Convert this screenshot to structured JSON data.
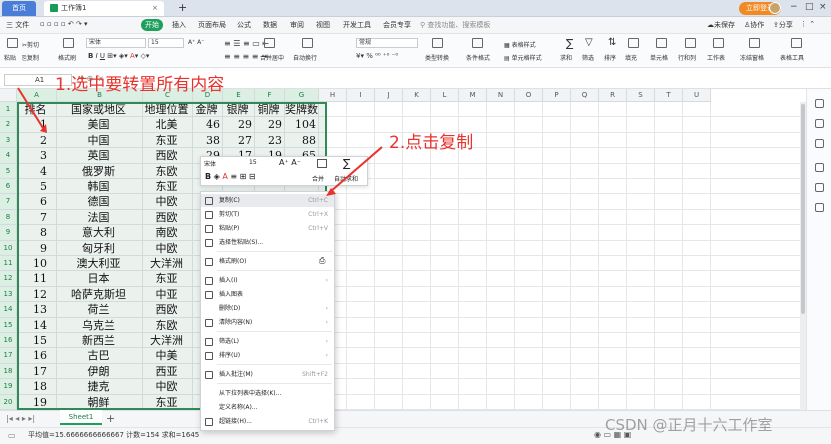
{
  "titlebar": {
    "home_tab": "首页",
    "doc_tab": "工作簿1",
    "login": "立即登录"
  },
  "menubar": {
    "file_menu": "三 文件",
    "items": [
      "开始",
      "插入",
      "页面布局",
      "公式",
      "数据",
      "审阅",
      "视图",
      "开发工具",
      "会员专享"
    ],
    "search_placeholder": "查找功能、搜索模板",
    "unsaved": "未保存",
    "collab": "协作",
    "share": "分享"
  },
  "ribbon": {
    "paste": "粘贴",
    "cut": "剪切",
    "copy": "复制",
    "format_painter": "格式刷",
    "font_name": "宋体",
    "font_size": "15",
    "merge_center": "合并居中",
    "auto_wrap": "自动换行",
    "number_format": "常规",
    "type_convert": "类型转换",
    "cond_format": "条件格式",
    "table_style": "表格样式",
    "cell_style": "单元格样式",
    "sum": "求和",
    "filter": "筛选",
    "sort": "排序",
    "fill": "填充",
    "cell": "单元格",
    "row_col": "行和列",
    "worksheet": "工作表",
    "freeze": "冻结窗格",
    "table_tools": "表格工具"
  },
  "formula": {
    "cell_ref": "A1"
  },
  "columns": [
    "A",
    "B",
    "C",
    "D",
    "E",
    "F",
    "G",
    "H",
    "I",
    "J",
    "K",
    "L",
    "M",
    "N",
    "O",
    "P",
    "Q",
    "R",
    "S",
    "T",
    "U"
  ],
  "rows": [
    "1",
    "2",
    "3",
    "4",
    "5",
    "6",
    "7",
    "8",
    "9",
    "10",
    "11",
    "12",
    "13",
    "14",
    "15",
    "16",
    "17",
    "18",
    "19",
    "20",
    "21",
    "22",
    "23"
  ],
  "table": {
    "headers": [
      "排名",
      "国家或地区",
      "地理位置",
      "金牌",
      "银牌",
      "铜牌",
      "奖牌数"
    ],
    "data": [
      [
        "1",
        "美国",
        "北美",
        "46",
        "29",
        "29",
        "104"
      ],
      [
        "2",
        "中国",
        "东亚",
        "38",
        "27",
        "23",
        "88"
      ],
      [
        "3",
        "英国",
        "西欧",
        "29",
        "17",
        "19",
        "65"
      ],
      [
        "4",
        "俄罗斯",
        "东欧",
        "",
        "",
        "",
        ""
      ],
      [
        "5",
        "韩国",
        "东亚",
        "",
        "",
        "",
        ""
      ],
      [
        "6",
        "德国",
        "中欧",
        "",
        "",
        "",
        ""
      ],
      [
        "7",
        "法国",
        "西欧",
        "",
        "",
        "",
        ""
      ],
      [
        "8",
        "意大利",
        "南欧",
        "",
        "",
        "",
        ""
      ],
      [
        "9",
        "匈牙利",
        "中欧",
        "",
        "",
        "",
        ""
      ],
      [
        "10",
        "澳大利亚",
        "大洋洲",
        "",
        "",
        "",
        ""
      ],
      [
        "11",
        "日本",
        "东亚",
        "",
        "",
        "",
        ""
      ],
      [
        "12",
        "哈萨克斯坦",
        "中亚",
        "",
        "",
        "",
        ""
      ],
      [
        "13",
        "荷兰",
        "西欧",
        "",
        "",
        "",
        ""
      ],
      [
        "14",
        "乌克兰",
        "东欧",
        "",
        "",
        "",
        ""
      ],
      [
        "15",
        "新西兰",
        "大洋洲",
        "",
        "",
        "",
        ""
      ],
      [
        "16",
        "古巴",
        "中美",
        "",
        "",
        "",
        ""
      ],
      [
        "17",
        "伊朗",
        "西亚",
        "",
        "",
        "",
        ""
      ],
      [
        "18",
        "捷克",
        "中欧",
        "",
        "",
        "",
        ""
      ],
      [
        "19",
        "朝鲜",
        "东亚",
        "",
        "",
        "",
        ""
      ],
      [
        "20",
        "西班牙",
        "南欧",
        "",
        "",
        "",
        ""
      ],
      [
        "21",
        "巴西",
        "南美",
        "",
        "",
        "",
        ""
      ]
    ]
  },
  "mini_toolbar": {
    "font": "宋体",
    "size": "15",
    "merge": "合并",
    "autosum": "自动求和"
  },
  "context_menu": [
    {
      "label": "复制(C)",
      "shortcut": "Ctrl+C",
      "icon": "copy-icon"
    },
    {
      "label": "剪切(T)",
      "shortcut": "Ctrl+X",
      "icon": "scissors-icon"
    },
    {
      "label": "粘贴(P)",
      "shortcut": "Ctrl+V",
      "icon": "paste-icon"
    },
    {
      "label": "选择性粘贴(S)...",
      "shortcut": "",
      "icon": "paste-special-icon"
    },
    {
      "label": "格式刷(O)",
      "shortcut": "",
      "icon": "format-brush-icon"
    },
    {
      "label": "插入(I)",
      "shortcut": "",
      "icon": "insert-icon"
    },
    {
      "label": "插入图表",
      "shortcut": "",
      "icon": "chart-icon"
    },
    {
      "label": "删除(D)",
      "shortcut": "",
      "icon": ""
    },
    {
      "label": "清除内容(N)",
      "shortcut": "",
      "icon": "eraser-icon"
    },
    {
      "label": "筛选(L)",
      "shortcut": "",
      "icon": "filter-icon"
    },
    {
      "label": "排序(U)",
      "shortcut": "",
      "icon": "sort-icon"
    },
    {
      "label": "插入批注(M)",
      "shortcut": "Shift+F2",
      "icon": "comment-icon"
    },
    {
      "label": "从下拉列表中选择(K)...",
      "shortcut": "",
      "icon": ""
    },
    {
      "label": "定义名称(A)...",
      "shortcut": "",
      "icon": ""
    },
    {
      "label": "超链接(H)...",
      "shortcut": "Ctrl+K",
      "icon": "link-icon"
    }
  ],
  "sheet": {
    "tab": "Sheet1"
  },
  "status": {
    "text": "平均值=15.6666666666667 计数=154 求和=1645"
  },
  "annotations": {
    "step1": "1.选中要转置所有内容",
    "step2": "2.点击复制"
  },
  "watermark": "CSDN @正月十六工作室"
}
